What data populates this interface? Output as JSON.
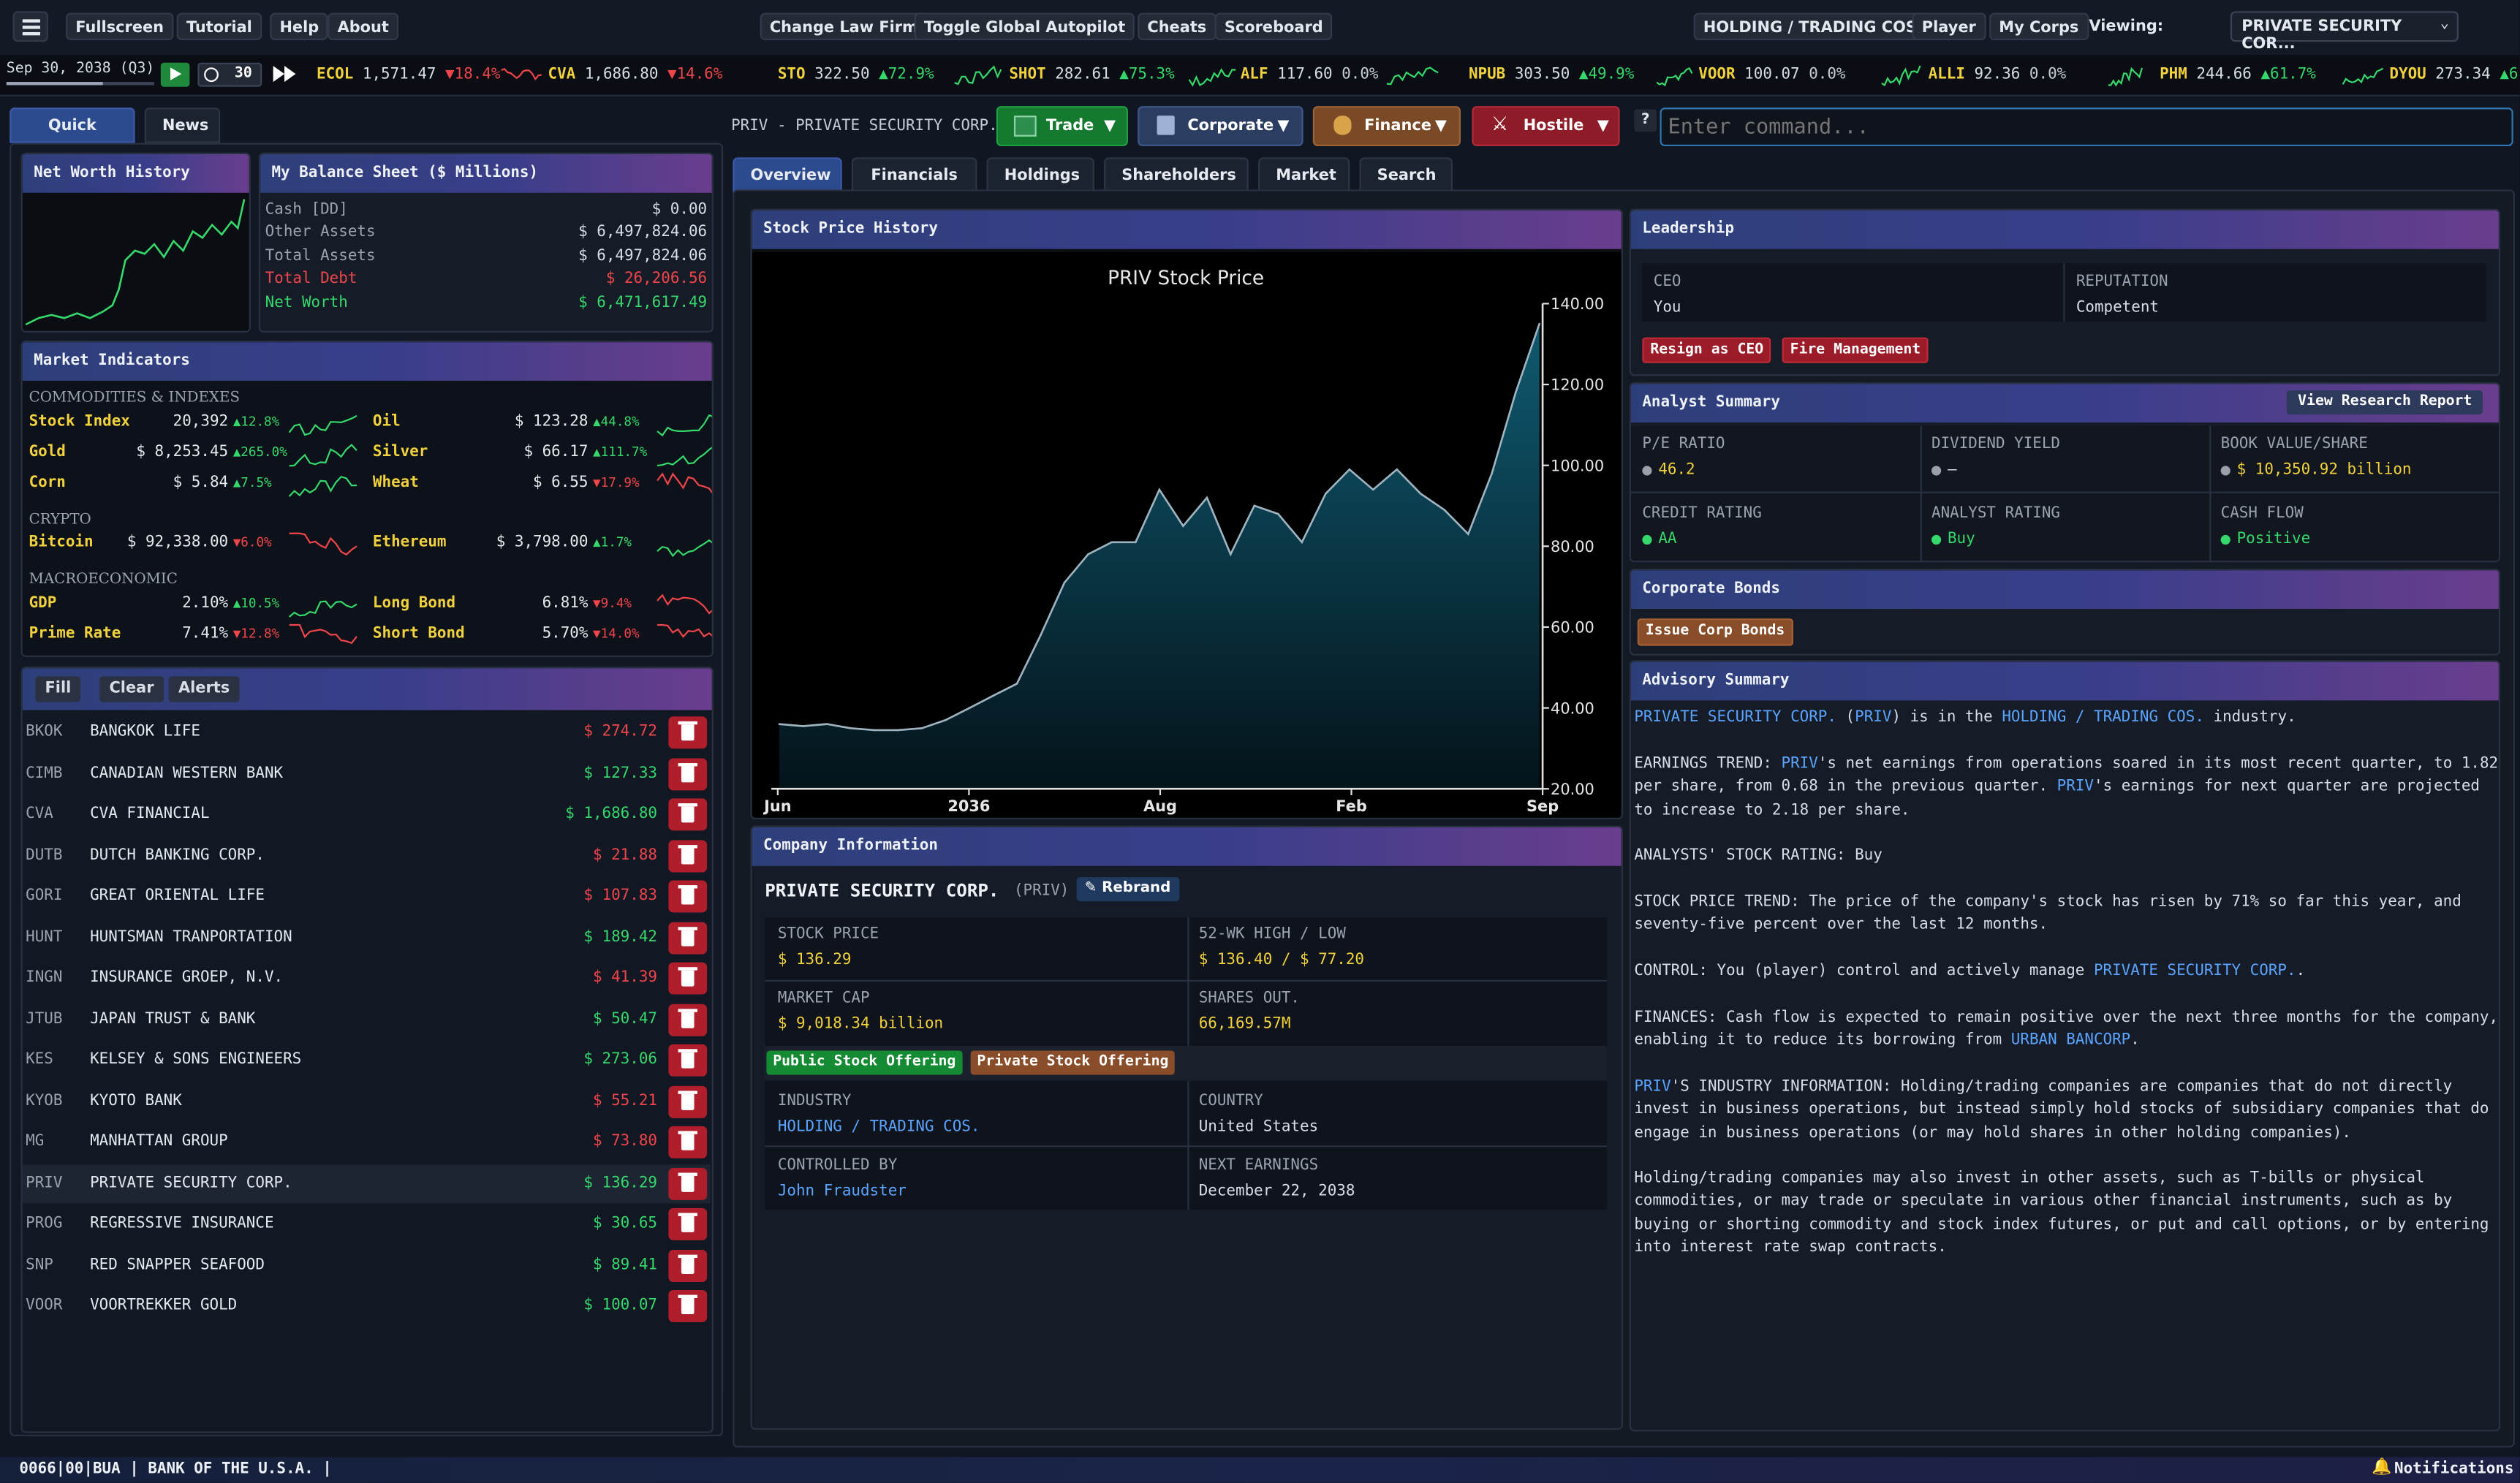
{
  "topbar": {
    "fullscreen": "Fullscreen",
    "tutorial": "Tutorial",
    "help": "Help",
    "about": "About",
    "change_law_firm": "Change Law Firm",
    "toggle_autopilot": "Toggle Global Autopilot",
    "cheats": "Cheats",
    "scoreboard": "Scoreboard",
    "industry": "HOLDING / TRADING COS.",
    "player": "Player",
    "my_corps": "My Corps",
    "viewing_label": "Viewing:",
    "viewing_value": "PRIVATE SECURITY COR..."
  },
  "timebar": {
    "date": "Sep 30, 2038 (Q3)",
    "speed": "30"
  },
  "ticker": [
    {
      "sym": "ECOL",
      "price": "1,571.47",
      "chg": "▼18.4%",
      "dir": "dn"
    },
    {
      "sym": "CVA",
      "price": "1,686.80",
      "chg": "▼14.6%",
      "dir": "dn"
    },
    {
      "sym": "STO",
      "price": "322.50",
      "chg": "▲72.9%",
      "dir": "up"
    },
    {
      "sym": "SHOT",
      "price": "282.61",
      "chg": "▲75.3%",
      "dir": "up"
    },
    {
      "sym": "ALF",
      "price": "117.60",
      "chg": "0.0%",
      "dir": "neu"
    },
    {
      "sym": "NPUB",
      "price": "303.50",
      "chg": "▲49.9%",
      "dir": "up"
    },
    {
      "sym": "VOOR",
      "price": "100.07",
      "chg": "0.0%",
      "dir": "neu"
    },
    {
      "sym": "ALLI",
      "price": "92.36",
      "chg": "0.0%",
      "dir": "neu"
    },
    {
      "sym": "PHM",
      "price": "244.66",
      "chg": "▲61.7%",
      "dir": "up"
    },
    {
      "sym": "DYOU",
      "price": "273.34",
      "chg": "▲6",
      "dir": "up"
    }
  ],
  "left_tabs": {
    "quick_look": "Quick Look",
    "news": "News"
  },
  "net_worth": {
    "title": "Net Worth History"
  },
  "balance_sheet": {
    "title": "My Balance Sheet ($ Millions)",
    "rows": [
      {
        "label": "Cash [DD]",
        "value": "$ 0.00",
        "tone": "normal"
      },
      {
        "label": "Other Assets",
        "value": "$ 6,497,824.06",
        "tone": "normal"
      },
      {
        "label": "Total Assets",
        "value": "$ 6,497,824.06",
        "tone": "normal"
      },
      {
        "label": "Total Debt",
        "value": "$ 26,206.56",
        "tone": "red"
      },
      {
        "label": "Net Worth",
        "value": "$ 6,471,617.49",
        "tone": "green"
      }
    ]
  },
  "market_indicators": {
    "title": "Market Indicators",
    "sections": {
      "commodities": "COMMODITIES & INDEXES",
      "crypto": "CRYPTO",
      "macro": "MACROECONOMIC"
    },
    "items": [
      {
        "name": "Stock Index",
        "value": "20,392",
        "chg": "▲12.8%",
        "dir": "up"
      },
      {
        "name": "Oil",
        "value": "$ 123.28",
        "chg": "▲44.8%",
        "dir": "up"
      },
      {
        "name": "Gold",
        "value": "$ 8,253.45",
        "chg": "▲265.0%",
        "dir": "up"
      },
      {
        "name": "Silver",
        "value": "$ 66.17",
        "chg": "▲111.7%",
        "dir": "up"
      },
      {
        "name": "Corn",
        "value": "$ 5.84",
        "chg": "▲7.5%",
        "dir": "up"
      },
      {
        "name": "Wheat",
        "value": "$ 6.55",
        "chg": "▼17.9%",
        "dir": "dn"
      },
      {
        "name": "Bitcoin",
        "value": "$ 92,338.00",
        "chg": "▼6.0%",
        "dir": "dn"
      },
      {
        "name": "Ethereum",
        "value": "$ 3,798.00",
        "chg": "▲1.7%",
        "dir": "up"
      },
      {
        "name": "GDP",
        "value": "2.10%",
        "chg": "▲10.5%",
        "dir": "up"
      },
      {
        "name": "Long Bond",
        "value": "6.81%",
        "chg": "▼9.4%",
        "dir": "dn"
      },
      {
        "name": "Prime Rate",
        "value": "7.41%",
        "chg": "▼12.8%",
        "dir": "dn"
      },
      {
        "name": "Short Bond",
        "value": "5.70%",
        "chg": "▼14.0%",
        "dir": "dn"
      }
    ]
  },
  "watchlist": {
    "fill": "Fill",
    "clear": "Clear",
    "alerts": "Alerts",
    "rows": [
      {
        "sym": "BKOK",
        "name": "BANGKOK LIFE",
        "price": "$ 274.72",
        "dir": "dn"
      },
      {
        "sym": "CIMB",
        "name": "CANADIAN WESTERN BANK",
        "price": "$ 127.33",
        "dir": "up"
      },
      {
        "sym": "CVA",
        "name": "CVA FINANCIAL",
        "price": "$ 1,686.80",
        "dir": "up"
      },
      {
        "sym": "DUTB",
        "name": "DUTCH BANKING CORP.",
        "price": "$ 21.88",
        "dir": "dn"
      },
      {
        "sym": "GORI",
        "name": "GREAT ORIENTAL LIFE",
        "price": "$ 107.83",
        "dir": "dn"
      },
      {
        "sym": "HUNT",
        "name": "HUNTSMAN TRANPORTATION",
        "price": "$ 189.42",
        "dir": "up"
      },
      {
        "sym": "INGN",
        "name": "INSURANCE GROEP, N.V.",
        "price": "$ 41.39",
        "dir": "dn"
      },
      {
        "sym": "JTUB",
        "name": "JAPAN TRUST & BANK",
        "price": "$ 50.47",
        "dir": "up"
      },
      {
        "sym": "KES",
        "name": "KELSEY & SONS ENGINEERS",
        "price": "$ 273.06",
        "dir": "up"
      },
      {
        "sym": "KYOB",
        "name": "KYOTO BANK",
        "price": "$ 55.21",
        "dir": "dn"
      },
      {
        "sym": "MG",
        "name": "MANHATTAN GROUP",
        "price": "$ 73.80",
        "dir": "dn"
      },
      {
        "sym": "PRIV",
        "name": "PRIVATE SECURITY CORP.",
        "price": "$ 136.29",
        "dir": "up"
      },
      {
        "sym": "PROG",
        "name": "REGRESSIVE INSURANCE",
        "price": "$ 30.65",
        "dir": "up"
      },
      {
        "sym": "SNP",
        "name": "RED SNAPPER SEAFOOD",
        "price": "$ 89.41",
        "dir": "up"
      },
      {
        "sym": "VOOR",
        "name": "VOORTREKKER GOLD",
        "price": "$ 100.07",
        "dir": "up"
      }
    ]
  },
  "company_bar": {
    "label": "PRIV - PRIVATE SECURITY CORP.",
    "trade": "Trade",
    "corporate": "Corporate",
    "finance": "Finance",
    "hostile": "Hostile",
    "help": "?",
    "command_placeholder": "Enter command..."
  },
  "main_tabs": [
    "Overview",
    "Financials",
    "Holdings",
    "Shareholders",
    "Market",
    "Search"
  ],
  "stock_panel": {
    "title": "Stock Price History"
  },
  "chart_data": {
    "type": "area",
    "title": "PRIV Stock Price",
    "xlabel": "",
    "ylabel": "",
    "ylim": [
      20,
      140
    ],
    "x_tick_labels": [
      "Jun",
      "2036",
      "Aug",
      "Feb",
      "Sep"
    ],
    "y_tick_labels": [
      "20.00",
      "40.00",
      "60.00",
      "80.00",
      "100.00",
      "120.00",
      "140.00"
    ],
    "values": [
      36,
      35.5,
      36,
      35,
      34.5,
      34.5,
      35,
      37,
      40,
      43,
      46,
      58,
      71,
      78,
      81,
      81,
      94,
      85,
      92,
      78,
      90,
      88,
      81,
      93,
      99,
      94,
      99,
      93,
      89,
      83,
      98,
      118,
      135
    ],
    "grid": false
  },
  "company_info": {
    "title": "Company Information",
    "name": "PRIVATE SECURITY CORP.",
    "ticker": "(PRIV)",
    "rebrand": "Rebrand",
    "stock_price_label": "STOCK PRICE",
    "stock_price": "$ 136.29",
    "hilo_label": "52-WK HIGH / LOW",
    "hilo": "$ 136.40 / $ 77.20",
    "mcap_label": "MARKET CAP",
    "mcap": "$ 9,018.34 billion",
    "shares_label": "SHARES OUT.",
    "shares": "66,169.57M",
    "public_offering": "Public Stock Offering",
    "private_offering": "Private Stock Offering",
    "industry_label": "INDUSTRY",
    "industry": "HOLDING / TRADING COS.",
    "country_label": "COUNTRY",
    "country": "United States",
    "controlled_label": "CONTROLLED BY",
    "controlled": "John Fraudster",
    "earnings_label": "NEXT EARNINGS",
    "earnings": "December 22, 2038"
  },
  "leadership": {
    "title": "Leadership",
    "ceo_label": "CEO",
    "ceo": "You",
    "rep_label": "REPUTATION",
    "rep": "Competent",
    "resign": "Resign as CEO",
    "fire": "Fire Management"
  },
  "analyst": {
    "title": "Analyst Summary",
    "research": "View Research Report",
    "pe_label": "P/E RATIO",
    "pe": "46.2",
    "div_label": "DIVIDEND YIELD",
    "div": "—",
    "bv_label": "BOOK VALUE/SHARE",
    "bv": "$ 10,350.92 billion",
    "credit_label": "CREDIT RATING",
    "credit": "AA",
    "rating_label": "ANALYST RATING",
    "rating": "Buy",
    "cf_label": "CASH FLOW",
    "cf": "Positive"
  },
  "bonds": {
    "title": "Corporate Bonds",
    "issue": "Issue Corp Bonds"
  },
  "advisory": {
    "title": "Advisory Summary",
    "p1a": "PRIVATE SECURITY CORP.",
    "p1b": " (",
    "p1c": "PRIV",
    "p1d": ") is in the ",
    "p1e": "HOLDING / TRADING COS.",
    "p1f": " industry.",
    "p2a": "EARNINGS TREND: ",
    "p2b": "PRIV",
    "p2c": "'s net earnings from operations soared in its most recent quarter, to 1.82 per share, from 0.68 in the previous quarter. ",
    "p2d": "PRIV",
    "p2e": "'s earnings for next quarter are projected to increase to 2.18 per share.",
    "p3": "ANALYSTS' STOCK RATING: Buy",
    "p4": "STOCK PRICE TREND: The price of the company's stock has risen by 71% so far this year, and seventy-five percent over the last 12 months.",
    "p5a": "CONTROL: You (player) control and actively manage ",
    "p5b": "PRIVATE SECURITY CORP.",
    "p5c": ".",
    "p6a": "FINANCES: Cash flow is expected to remain positive over the next three months for the company, enabling it to reduce its borrowing from ",
    "p6b": "URBAN BANCORP",
    "p6c": ".",
    "p7a": "PRIV",
    "p7b": "'S INDUSTRY INFORMATION: Holding/trading companies are companies that do not directly invest in business operations, but instead simply hold stocks of subsidiary companies that do engage in business operations (or may hold shares in other holding companies).",
    "p8": "Holding/trading companies may also invest in other assets, such as T-bills or physical commodities, or may trade or speculate in various other financial instruments, such as by buying or shorting commodity and stock index futures, or put and call options, or by entering into interest rate swap contracts."
  },
  "statusbar": {
    "text": "0066|00|BUA | BANK OF THE U.S.A. |",
    "notifications": "Notifications"
  },
  "colors": {
    "up": "#35d86b",
    "down": "#f0454a",
    "accent": "#2c4b8e",
    "header_grad": "#6a3d8e",
    "chart_fill": "#0f4a5e"
  }
}
